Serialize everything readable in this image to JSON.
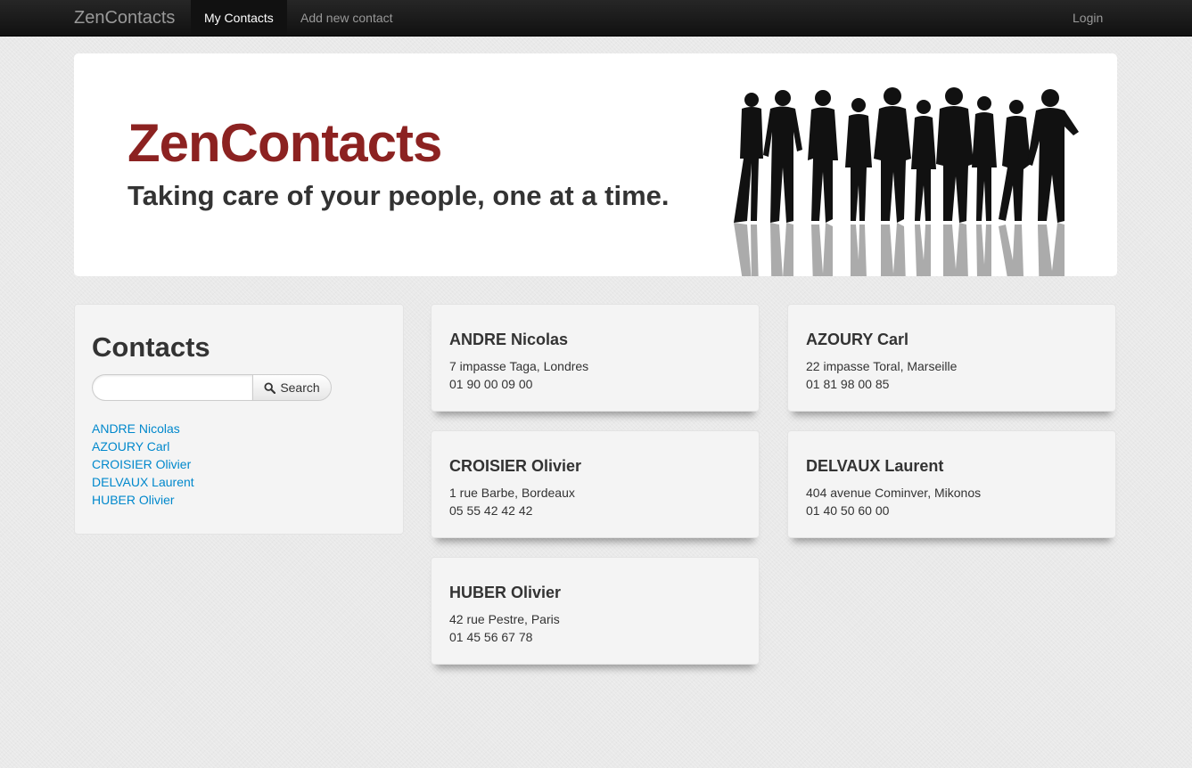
{
  "navbar": {
    "brand": "ZenContacts",
    "items": [
      {
        "label": "My Contacts",
        "active": true
      },
      {
        "label": "Add new contact",
        "active": false
      }
    ],
    "login": "Login"
  },
  "hero": {
    "title": "ZenContacts",
    "subtitle": "Taking care of your people, one at a time.",
    "image_icon": "people-silhouette-image"
  },
  "sidebar": {
    "title": "Contacts",
    "search": {
      "value": "",
      "placeholder": "",
      "button_label": "Search",
      "button_icon": "search-icon"
    },
    "contacts": [
      "ANDRE Nicolas",
      "AZOURY Carl",
      "CROISIER Olivier",
      "DELVAUX Laurent",
      "HUBER Olivier"
    ]
  },
  "cards": [
    {
      "name": "ANDRE Nicolas",
      "address": "7 impasse Taga, Londres",
      "phone": "01 90 00 09 00"
    },
    {
      "name": "AZOURY Carl",
      "address": "22 impasse Toral, Marseille",
      "phone": "01 81 98 00 85"
    },
    {
      "name": "CROISIER Olivier",
      "address": "1 rue Barbe, Bordeaux",
      "phone": "05 55 42 42 42"
    },
    {
      "name": "DELVAUX Laurent",
      "address": "404 avenue Cominver, Mikonos",
      "phone": "01 40 50 60 00"
    },
    {
      "name": "HUBER Olivier",
      "address": "42 rue Pestre, Paris",
      "phone": "01 45 56 67 78"
    }
  ],
  "colors": {
    "brand_red": "#8c2221",
    "link_blue": "#0088cc",
    "navbar": "#1b1b1b"
  }
}
